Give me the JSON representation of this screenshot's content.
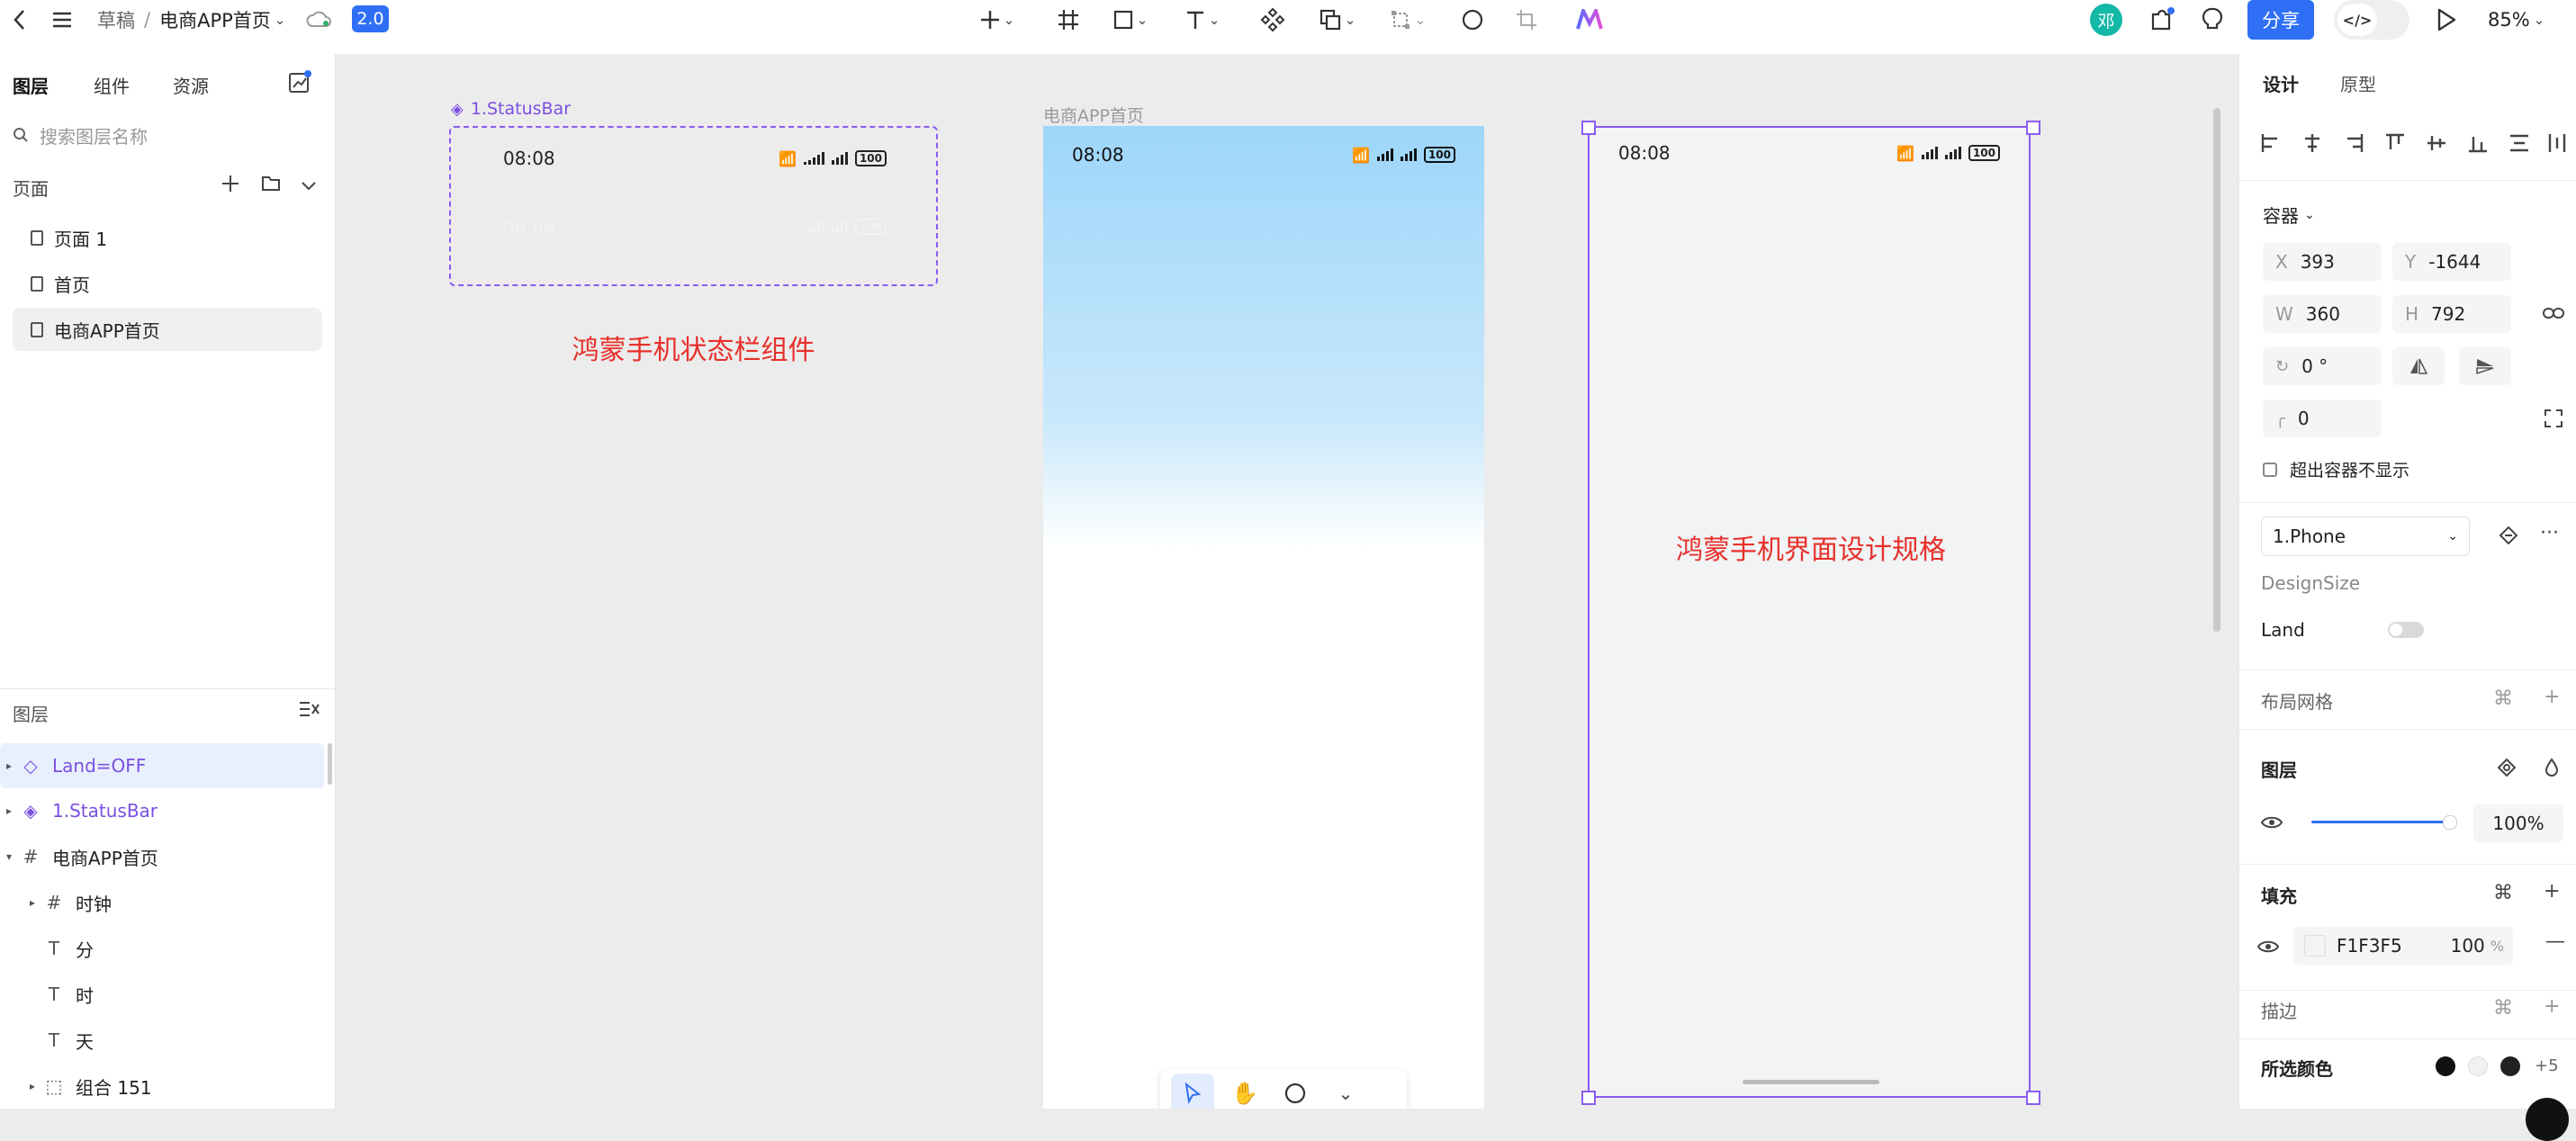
{
  "topbar": {
    "breadcrumb_root": "草稿",
    "breadcrumb_sep": "/",
    "file_name": "电商APP首页",
    "version_badge": "2.0",
    "avatar_letter": "邓",
    "share_label": "分享",
    "code_toggle": "</>",
    "zoom": "85%"
  },
  "left": {
    "tabs": [
      "图层",
      "组件",
      "资源"
    ],
    "search_placeholder": "搜索图层名称",
    "pages_title": "页面",
    "pages": [
      "页面 1",
      "首页",
      "电商APP首页"
    ],
    "layers_title": "图层",
    "layers": [
      {
        "name": "Land=OFF",
        "icon": "variant-icon"
      },
      {
        "name": "1.StatusBar",
        "icon": "component-icon"
      },
      {
        "name": "电商APP首页",
        "icon": "frame-icon"
      },
      {
        "name": "时钟",
        "icon": "frame-icon"
      },
      {
        "name": "分",
        "icon": "text-icon"
      },
      {
        "name": "时",
        "icon": "text-icon"
      },
      {
        "name": "天",
        "icon": "text-icon"
      },
      {
        "name": "组合 151",
        "icon": "group-icon"
      }
    ]
  },
  "canvas": {
    "statusbar_frame_label": "1.StatusBar",
    "statusbar_time": "08:08",
    "statusbar_battery": "100",
    "statusbar_caption": "鸿蒙手机状态栏组件",
    "app_frame_label": "电商APP首页",
    "app_time": "08:08",
    "app_battery": "100",
    "phone_time": "08:08",
    "phone_battery": "100",
    "phone_caption": "鸿蒙手机界面设计规格"
  },
  "right": {
    "tabs": [
      "设计",
      "原型"
    ],
    "container_label": "容器",
    "x_key": "X",
    "x_val": "393",
    "y_key": "Y",
    "y_val": "-1644",
    "w_key": "W",
    "w_val": "360",
    "h_key": "H",
    "h_val": "792",
    "rotation": "0 °",
    "radius": "0",
    "clip_label": "超出容器不显示",
    "preset": "1.Phone",
    "design_size_label": "DesignSize",
    "land_label": "Land",
    "grid_label": "布局网格",
    "layer_label": "图层",
    "opacity": "100%",
    "fill_label": "填充",
    "fill_hex": "F1F3F5",
    "fill_opacity": "100",
    "fill_pct": "%",
    "stroke_label": "描边",
    "selected_colors_label": "所选颜色",
    "more_colors": "+5"
  },
  "colors": {
    "accent": "#2f6ff5",
    "purple": "#7b4fe0",
    "red_caption": "#e8302b",
    "fill": "#F1F3F5",
    "avatar": "#13b8a6"
  }
}
